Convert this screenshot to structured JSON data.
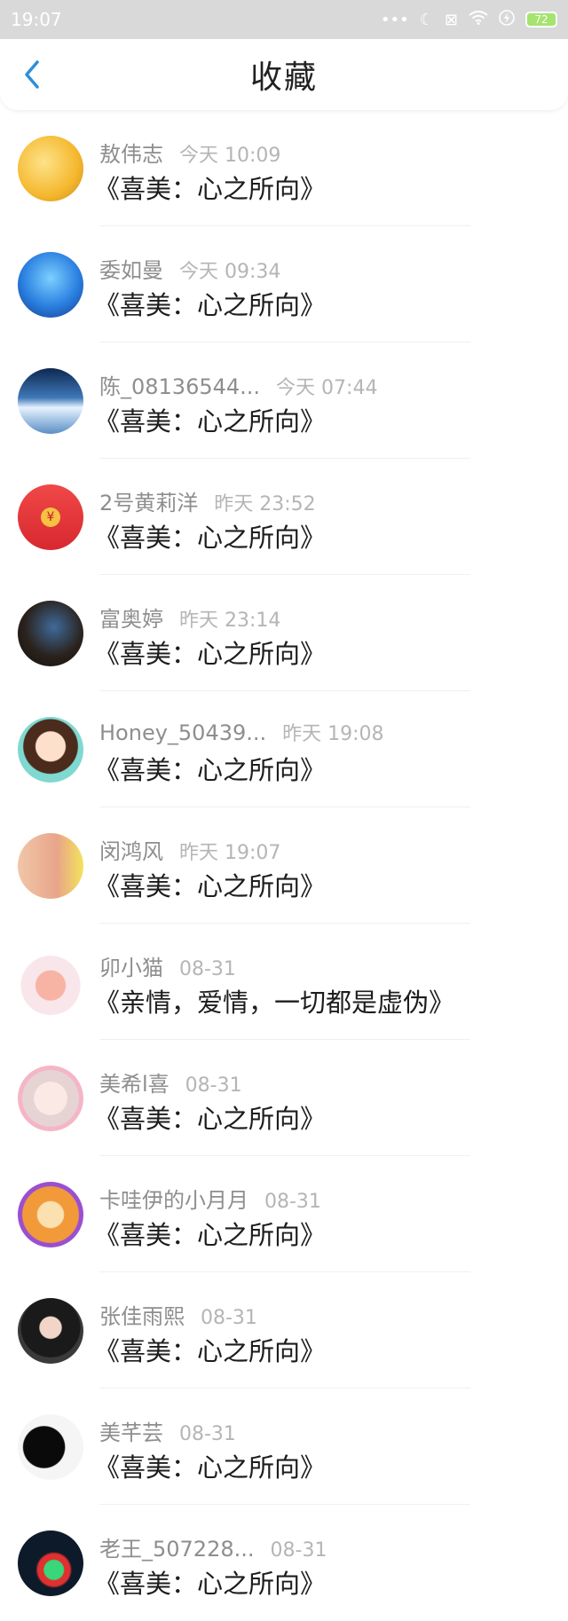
{
  "status_bar": {
    "time": "19:07",
    "battery": "72"
  },
  "header": {
    "title": "收藏"
  },
  "items": [
    {
      "username": "敖伟志",
      "time": "今天 10:09",
      "title": "《喜美：心之所向》",
      "avatar_color": "#f5b82e"
    },
    {
      "username": "委如曼",
      "time": "今天 09:34",
      "title": "《喜美：心之所向》",
      "avatar_color": "#2a7fe0"
    },
    {
      "username": "陈_08136544...",
      "time": "今天 07:44",
      "title": "《喜美：心之所向》",
      "avatar_color": "#1c3d6e"
    },
    {
      "username": "2号黄莉洋",
      "time": "昨天 23:52",
      "title": "《喜美：心之所向》",
      "avatar_color": "#d7282f"
    },
    {
      "username": "富奥婷",
      "time": "昨天 23:14",
      "title": "《喜美：心之所向》",
      "avatar_color": "#3a2f2a"
    },
    {
      "username": "Honey_50439...",
      "time": "昨天 19:08",
      "title": "《喜美：心之所向》",
      "avatar_color": "#6fcfc5"
    },
    {
      "username": "闵鸿风",
      "time": "昨天 19:07",
      "title": "《喜美：心之所向》",
      "avatar_color": "#e8b48f"
    },
    {
      "username": "卯小猫",
      "time": "08-31",
      "title": "《亲情，爱情，一切都是虚伪》",
      "avatar_color": "#f4c9d4"
    },
    {
      "username": "美希l喜",
      "time": "08-31",
      "title": "《喜美：心之所向》",
      "avatar_color": "#e9dede"
    },
    {
      "username": "卡哇伊的小月月",
      "time": "08-31",
      "title": "《喜美：心之所向》",
      "avatar_color": "#f29a3a"
    },
    {
      "username": "张佳雨熙",
      "time": "08-31",
      "title": "《喜美：心之所向》",
      "avatar_color": "#2a2a2a"
    },
    {
      "username": "美芊芸",
      "time": "08-31",
      "title": "《喜美：心之所向》",
      "avatar_color": "#111111"
    },
    {
      "username": "老王_507228...",
      "time": "08-31",
      "title": "《喜美：心之所向》",
      "avatar_color": "#0d1a2a"
    }
  ]
}
